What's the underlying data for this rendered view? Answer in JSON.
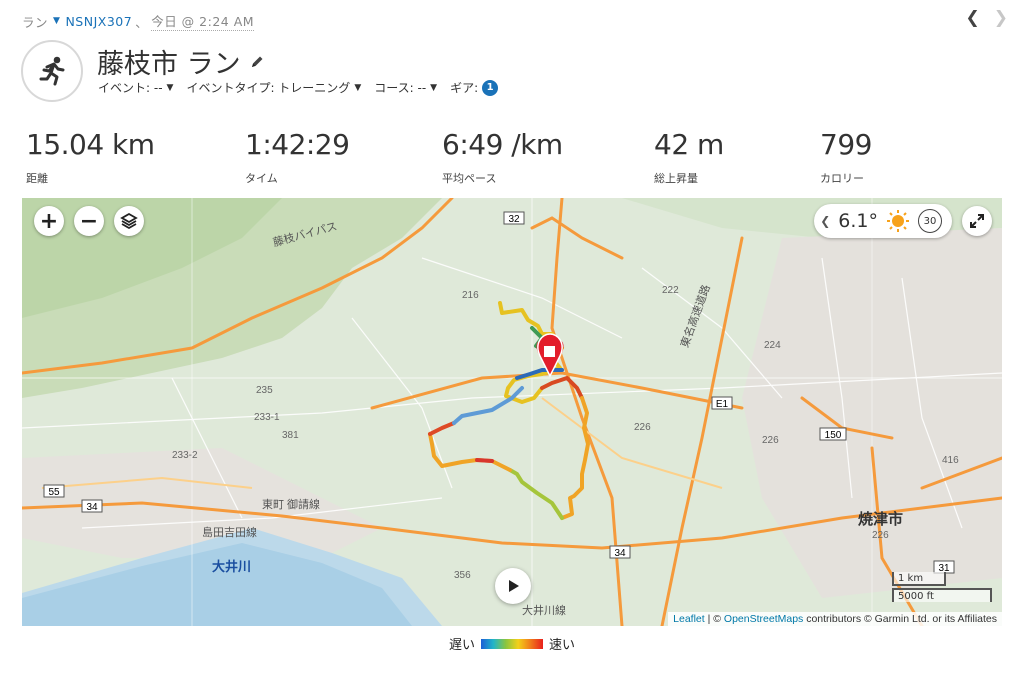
{
  "breadcrumb": {
    "activity_type": "ラン",
    "device": "NSNJX307",
    "separator": "、",
    "date": "今日 @ 2:24 AM"
  },
  "header": {
    "title": "藤枝市 ラン",
    "event_label": "イベント: --",
    "event_type_label": "イベントタイプ: トレーニング",
    "course_label": "コース: --",
    "gear_label": "ギア:",
    "gear_count": "1"
  },
  "stats": [
    {
      "value": "15.04 km",
      "label": "距離"
    },
    {
      "value": "1:42:29",
      "label": "タイム"
    },
    {
      "value": "6:49 /km",
      "label": "平均ペース"
    },
    {
      "value": "42 m",
      "label": "総上昇量"
    },
    {
      "value": "799",
      "label": "カロリー"
    }
  ],
  "map": {
    "weather_temp": "6.1°",
    "weather_badge": "30",
    "city_label": "焼津市",
    "river_label": "大井川",
    "scale_km": "1 km",
    "scale_ft": "5000 ft",
    "attribution_leaflet": "Leaflet",
    "attribution_mid": " | © ",
    "attribution_osm": "OpenStreetMaps",
    "attribution_tail": " contributors © Garmin Ltd. or its Affiliates",
    "road_labels": [
      "32",
      "E1",
      "150",
      "34",
      "34",
      "55",
      "31",
      "216",
      "222",
      "224",
      "226",
      "381",
      "356",
      "416",
      "235",
      "233-1",
      "233-2"
    ],
    "place_labels": [
      "藤枝バイパス",
      "東名高速道路",
      "島田吉田線",
      "東町 御請線",
      "大井川線"
    ]
  },
  "legend": {
    "slow": "遅い",
    "fast": "速い"
  },
  "colors": {
    "link": "#1a72b8",
    "pin": "#e31d2b",
    "road": "#f59a3c"
  }
}
